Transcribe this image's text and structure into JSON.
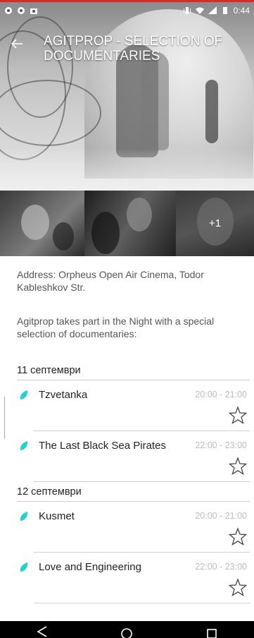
{
  "status_bar": {
    "time": "0:44",
    "left_icons": [
      "notification-icon",
      "notification-icon",
      "photo-icon"
    ],
    "right_icons": [
      "vibrate-icon",
      "wifi-icon",
      "signal-icon",
      "battery-icon"
    ]
  },
  "header": {
    "title": "AGITPROP - SELECTION OF DOCUMENTARIES",
    "back_icon": "back-arrow-icon"
  },
  "gallery": {
    "more_label": "+1"
  },
  "info": {
    "address": "Address: Orpheus Open Air Cinema, Todor Kableshkov Str.",
    "description": "Agitprop takes part in the Night with a special selection of documentaries:"
  },
  "schedule": [
    {
      "date": "11 септември",
      "events": [
        {
          "name": "Tzvetanka",
          "time": "20:00 - 21:00"
        },
        {
          "name": "The Last Black Sea Pirates",
          "time": "22:00 - 23:00"
        }
      ]
    },
    {
      "date": "12 септември",
      "events": [
        {
          "name": "Kusmet",
          "time": "20:00 - 21:00"
        },
        {
          "name": "Love and Engineering",
          "time": "22:00 - 23:00"
        }
      ]
    }
  ],
  "colors": {
    "accent": "#1ed3d0",
    "top_edge": "#d82b22"
  }
}
